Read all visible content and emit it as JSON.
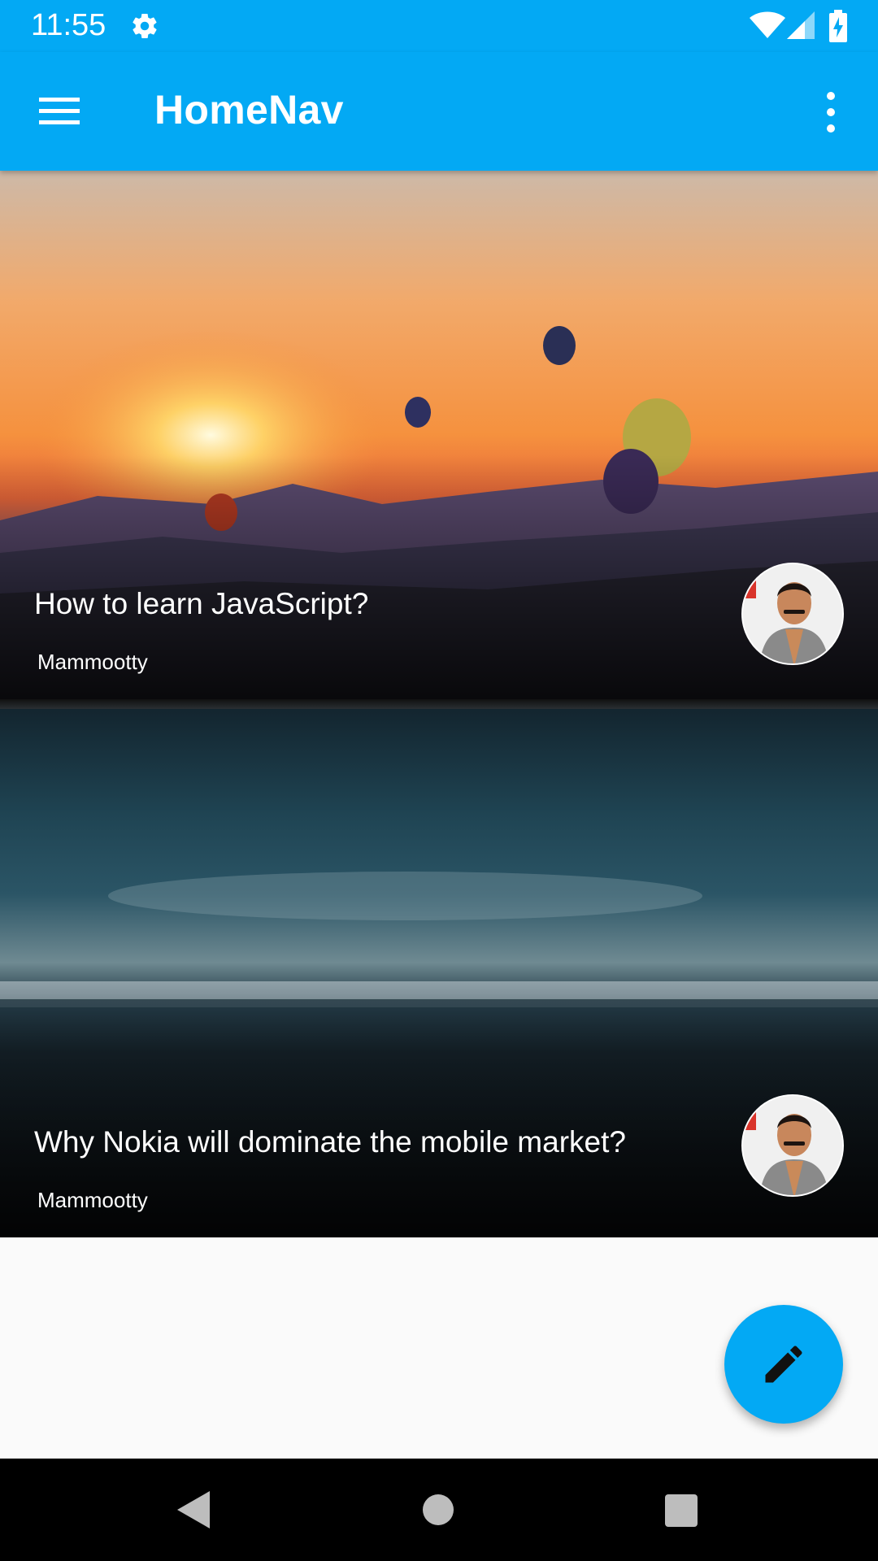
{
  "status_bar": {
    "time": "11:55",
    "icons": [
      "gear-icon",
      "wifi-icon",
      "signal-icon",
      "battery-charging-icon"
    ]
  },
  "app_bar": {
    "title": "HomeNav",
    "menu_icon": "hamburger-menu-icon",
    "overflow_icon": "more-vert-icon",
    "color": "#03a9f4"
  },
  "feed": {
    "cards": [
      {
        "title": "How to learn JavaScript?",
        "author": "Mammootty",
        "image": "hot-air-balloons-sunset-image",
        "avatar": "author-avatar"
      },
      {
        "title": "Why Nokia will dominate the mobile market?",
        "author": "Mammootty",
        "image": "city-lights-night-image",
        "avatar": "author-avatar"
      }
    ]
  },
  "fab": {
    "icon": "edit-pencil-icon",
    "color": "#03a9f4"
  },
  "nav_bar": {
    "icons": [
      "back-icon",
      "home-icon",
      "recents-icon"
    ]
  }
}
